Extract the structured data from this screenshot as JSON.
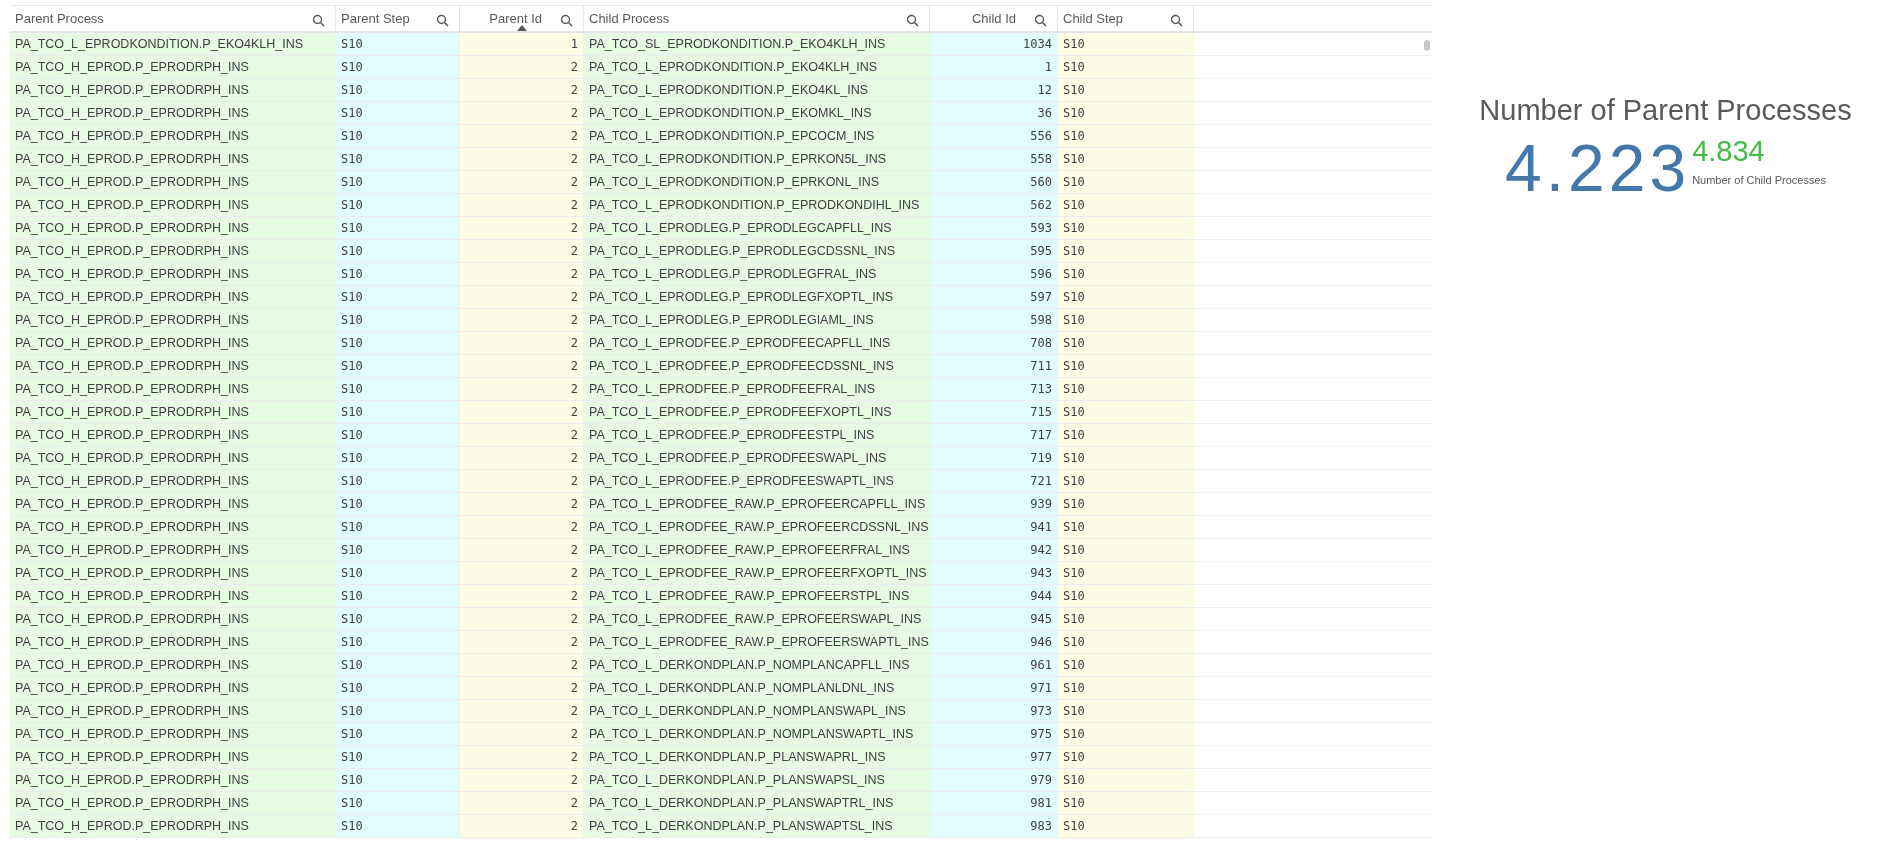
{
  "table": {
    "columns": [
      {
        "label": "Parent Process",
        "kind": "text",
        "sorted": false
      },
      {
        "label": "Parent Step",
        "kind": "code",
        "sorted": false
      },
      {
        "label": "Parent Id",
        "kind": "number",
        "sorted": true
      },
      {
        "label": "Child Process",
        "kind": "text",
        "sorted": false
      },
      {
        "label": "Child Id",
        "kind": "number",
        "sorted": false
      },
      {
        "label": "Child Step",
        "kind": "code",
        "sorted": false
      }
    ],
    "rows": [
      [
        "PA_TCO_L_EPRODKONDITION.P_EKO4KLH_INS",
        "S10",
        "1",
        "PA_TCO_SL_EPRODKONDITION.P_EKO4KLH_INS",
        "1034",
        "S10"
      ],
      [
        "PA_TCO_H_EPROD.P_EPRODRPH_INS",
        "S10",
        "2",
        "PA_TCO_L_EPRODKONDITION.P_EKO4KLH_INS",
        "1",
        "S10"
      ],
      [
        "PA_TCO_H_EPROD.P_EPRODRPH_INS",
        "S10",
        "2",
        "PA_TCO_L_EPRODKONDITION.P_EKO4KL_INS",
        "12",
        "S10"
      ],
      [
        "PA_TCO_H_EPROD.P_EPRODRPH_INS",
        "S10",
        "2",
        "PA_TCO_L_EPRODKONDITION.P_EKOMKL_INS",
        "36",
        "S10"
      ],
      [
        "PA_TCO_H_EPROD.P_EPRODRPH_INS",
        "S10",
        "2",
        "PA_TCO_L_EPRODKONDITION.P_EPCOCM_INS",
        "556",
        "S10"
      ],
      [
        "PA_TCO_H_EPROD.P_EPRODRPH_INS",
        "S10",
        "2",
        "PA_TCO_L_EPRODKONDITION.P_EPRKON5L_INS",
        "558",
        "S10"
      ],
      [
        "PA_TCO_H_EPROD.P_EPRODRPH_INS",
        "S10",
        "2",
        "PA_TCO_L_EPRODKONDITION.P_EPRKONL_INS",
        "560",
        "S10"
      ],
      [
        "PA_TCO_H_EPROD.P_EPRODRPH_INS",
        "S10",
        "2",
        "PA_TCO_L_EPRODKONDITION.P_EPRODKONDIHL_INS",
        "562",
        "S10"
      ],
      [
        "PA_TCO_H_EPROD.P_EPRODRPH_INS",
        "S10",
        "2",
        "PA_TCO_L_EPRODLEG.P_EPRODLEGCAPFLL_INS",
        "593",
        "S10"
      ],
      [
        "PA_TCO_H_EPROD.P_EPRODRPH_INS",
        "S10",
        "2",
        "PA_TCO_L_EPRODLEG.P_EPRODLEGCDSSNL_INS",
        "595",
        "S10"
      ],
      [
        "PA_TCO_H_EPROD.P_EPRODRPH_INS",
        "S10",
        "2",
        "PA_TCO_L_EPRODLEG.P_EPRODLEGFRAL_INS",
        "596",
        "S10"
      ],
      [
        "PA_TCO_H_EPROD.P_EPRODRPH_INS",
        "S10",
        "2",
        "PA_TCO_L_EPRODLEG.P_EPRODLEGFXOPTL_INS",
        "597",
        "S10"
      ],
      [
        "PA_TCO_H_EPROD.P_EPRODRPH_INS",
        "S10",
        "2",
        "PA_TCO_L_EPRODLEG.P_EPRODLEGIAML_INS",
        "598",
        "S10"
      ],
      [
        "PA_TCO_H_EPROD.P_EPRODRPH_INS",
        "S10",
        "2",
        "PA_TCO_L_EPRODFEE.P_EPRODFEECAPFLL_INS",
        "708",
        "S10"
      ],
      [
        "PA_TCO_H_EPROD.P_EPRODRPH_INS",
        "S10",
        "2",
        "PA_TCO_L_EPRODFEE.P_EPRODFEECDSSNL_INS",
        "711",
        "S10"
      ],
      [
        "PA_TCO_H_EPROD.P_EPRODRPH_INS",
        "S10",
        "2",
        "PA_TCO_L_EPRODFEE.P_EPRODFEEFRAL_INS",
        "713",
        "S10"
      ],
      [
        "PA_TCO_H_EPROD.P_EPRODRPH_INS",
        "S10",
        "2",
        "PA_TCO_L_EPRODFEE.P_EPRODFEEFXOPTL_INS",
        "715",
        "S10"
      ],
      [
        "PA_TCO_H_EPROD.P_EPRODRPH_INS",
        "S10",
        "2",
        "PA_TCO_L_EPRODFEE.P_EPRODFEESTPL_INS",
        "717",
        "S10"
      ],
      [
        "PA_TCO_H_EPROD.P_EPRODRPH_INS",
        "S10",
        "2",
        "PA_TCO_L_EPRODFEE.P_EPRODFEESWAPL_INS",
        "719",
        "S10"
      ],
      [
        "PA_TCO_H_EPROD.P_EPRODRPH_INS",
        "S10",
        "2",
        "PA_TCO_L_EPRODFEE.P_EPRODFEESWAPTL_INS",
        "721",
        "S10"
      ],
      [
        "PA_TCO_H_EPROD.P_EPRODRPH_INS",
        "S10",
        "2",
        "PA_TCO_L_EPRODFEE_RAW.P_EPROFEERCAPFLL_INS",
        "939",
        "S10"
      ],
      [
        "PA_TCO_H_EPROD.P_EPRODRPH_INS",
        "S10",
        "2",
        "PA_TCO_L_EPRODFEE_RAW.P_EPROFEERCDSSNL_INS",
        "941",
        "S10"
      ],
      [
        "PA_TCO_H_EPROD.P_EPRODRPH_INS",
        "S10",
        "2",
        "PA_TCO_L_EPRODFEE_RAW.P_EPROFEERFRAL_INS",
        "942",
        "S10"
      ],
      [
        "PA_TCO_H_EPROD.P_EPRODRPH_INS",
        "S10",
        "2",
        "PA_TCO_L_EPRODFEE_RAW.P_EPROFEERFXOPTL_INS",
        "943",
        "S10"
      ],
      [
        "PA_TCO_H_EPROD.P_EPRODRPH_INS",
        "S10",
        "2",
        "PA_TCO_L_EPRODFEE_RAW.P_EPROFEERSTPL_INS",
        "944",
        "S10"
      ],
      [
        "PA_TCO_H_EPROD.P_EPRODRPH_INS",
        "S10",
        "2",
        "PA_TCO_L_EPRODFEE_RAW.P_EPROFEERSWAPL_INS",
        "945",
        "S10"
      ],
      [
        "PA_TCO_H_EPROD.P_EPRODRPH_INS",
        "S10",
        "2",
        "PA_TCO_L_EPRODFEE_RAW.P_EPROFEERSWAPTL_INS",
        "946",
        "S10"
      ],
      [
        "PA_TCO_H_EPROD.P_EPRODRPH_INS",
        "S10",
        "2",
        "PA_TCO_L_DERKONDPLAN.P_NOMPLANCAPFLL_INS",
        "961",
        "S10"
      ],
      [
        "PA_TCO_H_EPROD.P_EPRODRPH_INS",
        "S10",
        "2",
        "PA_TCO_L_DERKONDPLAN.P_NOMPLANLDNL_INS",
        "971",
        "S10"
      ],
      [
        "PA_TCO_H_EPROD.P_EPRODRPH_INS",
        "S10",
        "2",
        "PA_TCO_L_DERKONDPLAN.P_NOMPLANSWAPL_INS",
        "973",
        "S10"
      ],
      [
        "PA_TCO_H_EPROD.P_EPRODRPH_INS",
        "S10",
        "2",
        "PA_TCO_L_DERKONDPLAN.P_NOMPLANSWAPTL_INS",
        "975",
        "S10"
      ],
      [
        "PA_TCO_H_EPROD.P_EPRODRPH_INS",
        "S10",
        "2",
        "PA_TCO_L_DERKONDPLAN.P_PLANSWAPRL_INS",
        "977",
        "S10"
      ],
      [
        "PA_TCO_H_EPROD.P_EPRODRPH_INS",
        "S10",
        "2",
        "PA_TCO_L_DERKONDPLAN.P_PLANSWAPSL_INS",
        "979",
        "S10"
      ],
      [
        "PA_TCO_H_EPROD.P_EPRODRPH_INS",
        "S10",
        "2",
        "PA_TCO_L_DERKONDPLAN.P_PLANSWAPTRL_INS",
        "981",
        "S10"
      ],
      [
        "PA_TCO_H_EPROD.P_EPRODRPH_INS",
        "S10",
        "2",
        "PA_TCO_L_DERKONDPLAN.P_PLANSWAPTSL_INS",
        "983",
        "S10"
      ]
    ]
  },
  "kpi": {
    "title": "Number of Parent Processes",
    "main_value": "4.223",
    "secondary_value": "4.834",
    "secondary_label": "Number of Child Processes"
  }
}
